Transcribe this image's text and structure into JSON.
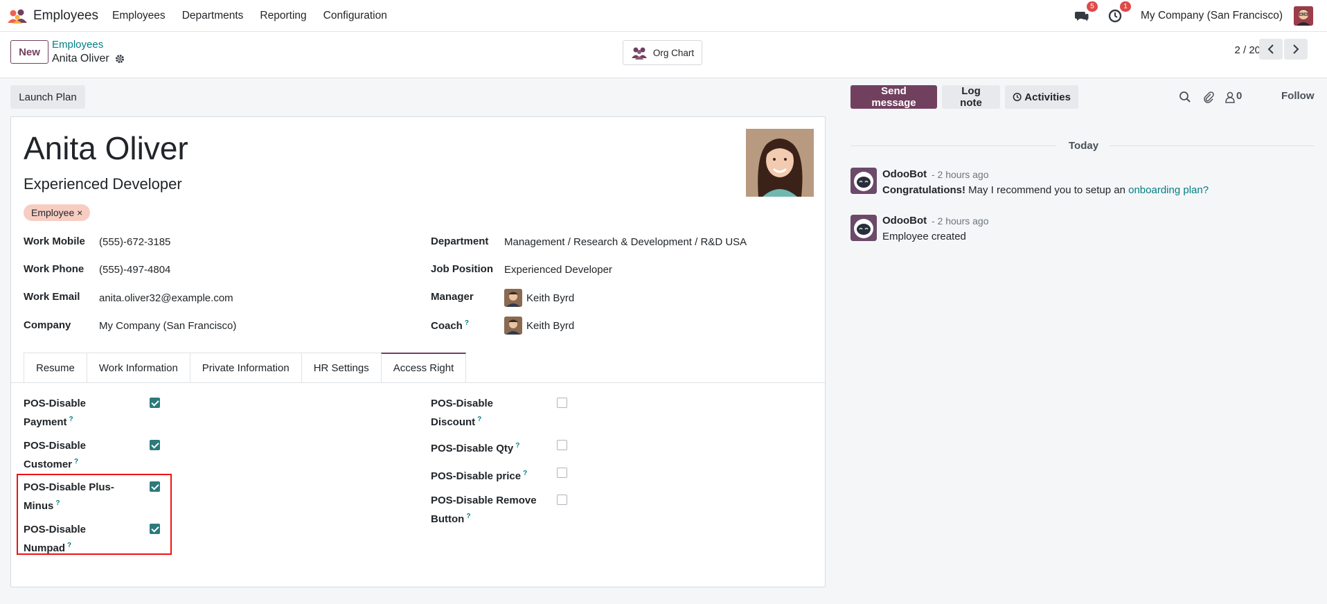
{
  "nav": {
    "app_name": "Employees",
    "menu": [
      "Employees",
      "Departments",
      "Reporting",
      "Configuration"
    ],
    "messages_badge": "5",
    "activity_badge": "1",
    "company": "My Company (San Francisco)"
  },
  "control": {
    "new_label": "New",
    "breadcrumb_parent": "Employees",
    "breadcrumb_current": "Anita Oliver",
    "org_chart_label": "Org Chart",
    "pager": "2 / 20"
  },
  "form": {
    "launch_plan_label": "Launch Plan",
    "name": "Anita Oliver",
    "job_title": "Experienced Developer",
    "tag": "Employee",
    "tag_remove": "×",
    "work_mobile_label": "Work Mobile",
    "work_mobile": "(555)-672-3185",
    "work_phone_label": "Work Phone",
    "work_phone": "(555)-497-4804",
    "work_email_label": "Work Email",
    "work_email": "anita.oliver32@example.com",
    "company_label": "Company",
    "company": "My Company (San Francisco)",
    "department_label": "Department",
    "department": "Management / Research & Development / R&D USA",
    "job_position_label": "Job Position",
    "job_position": "Experienced Developer",
    "manager_label": "Manager",
    "manager": "Keith Byrd",
    "coach_label": "Coach",
    "coach": "Keith Byrd",
    "help_mark": "?"
  },
  "tabs": [
    "Resume",
    "Work Information",
    "Private Information",
    "HR Settings",
    "Access Right"
  ],
  "access_rights": {
    "left": [
      {
        "line1": "POS-Disable",
        "line2": "Payment",
        "checked": true
      },
      {
        "line1": "POS-Disable",
        "line2": "Customer",
        "checked": true
      },
      {
        "line1": "POS-Disable Plus-",
        "line2": "Minus",
        "checked": true
      },
      {
        "line1": "POS-Disable",
        "line2": "Numpad",
        "checked": true
      }
    ],
    "right": [
      {
        "line1": "POS-Disable",
        "line2": "Discount",
        "checked": false
      },
      {
        "line1": "POS-Disable Qty",
        "line2": "",
        "checked": false
      },
      {
        "line1": "POS-Disable price",
        "line2": "",
        "checked": false
      },
      {
        "line1": "POS-Disable Remove",
        "line2": "Button",
        "checked": false
      }
    ]
  },
  "chatter": {
    "send_message": "Send message",
    "log_note": "Log note",
    "activities": "Activities",
    "followers_count": "0",
    "follow": "Follow",
    "today": "Today",
    "messages": [
      {
        "author": "OdooBot",
        "time": "- 2 hours ago",
        "bold": "Congratulations!",
        "text": " May I recommend you to setup an ",
        "link": "onboarding plan?"
      },
      {
        "author": "OdooBot",
        "time": "- 2 hours ago",
        "text": "Employee created"
      }
    ]
  },
  "colors": {
    "brand": "#71405f",
    "teal": "#017e84",
    "check": "#2c7a7b",
    "highlight": "#e11111"
  }
}
